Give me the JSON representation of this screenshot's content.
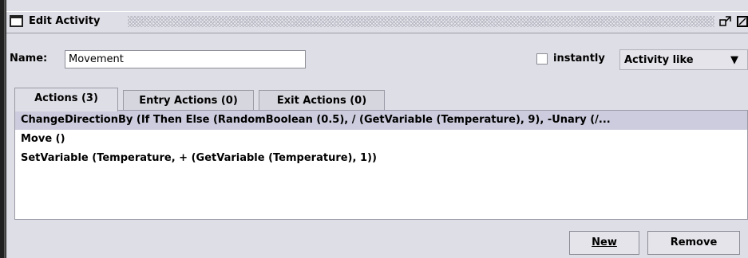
{
  "window": {
    "title": "Edit Activity",
    "restore_icon": "restore-down-icon",
    "maximize_icon": "maximize-icon"
  },
  "form": {
    "name_label": "Name:",
    "name_value": "Movement",
    "instantly_label": "instantly",
    "instantly_checked": false,
    "mode_selected": "Activity like"
  },
  "tabs": [
    {
      "label": "Actions (3)",
      "active": true
    },
    {
      "label": "Entry Actions (0)",
      "active": false
    },
    {
      "label": "Exit Actions (0)",
      "active": false
    }
  ],
  "actions": [
    "ChangeDirectionBy (If Then Else (RandomBoolean (0.5), / (GetVariable (Temperature), 9), -Unary (/...",
    "Move ()",
    "SetVariable (Temperature, + (GetVariable (Temperature), 1))"
  ],
  "buttons": {
    "new_label": "New",
    "remove_label": "Remove"
  },
  "colors": {
    "selection": "#ccccde",
    "background": "#dedee6"
  }
}
